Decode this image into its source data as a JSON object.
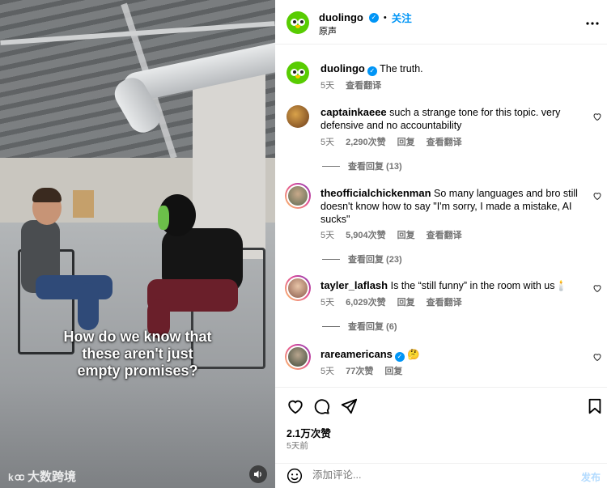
{
  "video": {
    "subtitle_lines": [
      "How do we know that",
      "these aren't just",
      "empty promises?"
    ],
    "watermark": "大数跨境",
    "volume_icon": "speaker-icon"
  },
  "post": {
    "author": "duolingo",
    "follow_label": "关注",
    "separator": "•",
    "audio_label": "原声",
    "more_icon": "more-horizontal-icon",
    "caption_author": "duolingo",
    "caption_text": "The truth.",
    "caption_time": "5天",
    "caption_translate": "查看翻译"
  },
  "comments": [
    {
      "username": "captainkaeee",
      "text": "such a strange tone for this topic. very defensive and no accountability",
      "time": "5天",
      "likes": "2,290次赞",
      "reply": "回复",
      "translate": "查看翻译",
      "view_replies": "查看回复 (13)"
    },
    {
      "username": "theofficialchickenman",
      "text": "So many languages and bro still doesn't know how to say \"I'm sorry, I made a mistake, AI sucks\"",
      "time": "5天",
      "likes": "5,904次赞",
      "reply": "回复",
      "translate": "查看翻译",
      "view_replies": "查看回复 (23)"
    },
    {
      "username": "tayler_laflash",
      "text": "Is the “still funny” in the room with us🕯️",
      "time": "5天",
      "likes": "6,029次赞",
      "reply": "回复",
      "translate": "查看翻译",
      "view_replies": "查看回复 (6)"
    },
    {
      "username": "rareamericans",
      "text": "🤔",
      "time": "5天",
      "likes": "77次赞",
      "reply": "回复"
    }
  ],
  "footer": {
    "likes": "2.1万次赞",
    "posted": "5天前",
    "comment_placeholder": "添加评论...",
    "post_label": "发布"
  },
  "colors": {
    "brand_green": "#58cc02",
    "link_blue": "#0095f6",
    "muted_gray": "#737373",
    "verified_blue": "#0095f6"
  }
}
